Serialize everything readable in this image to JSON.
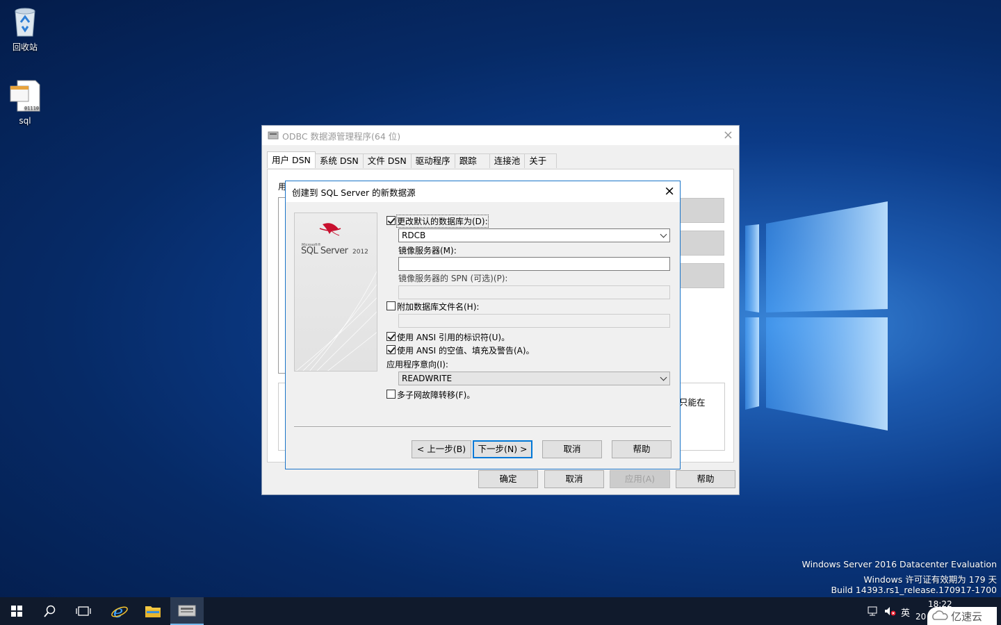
{
  "desktop": {
    "icons": [
      {
        "label": "回收站",
        "icon": "recycle-bin-icon"
      },
      {
        "label": "sql",
        "icon": "dsn-file-icon"
      }
    ],
    "watermark": {
      "line1": "Windows Server 2016 Datacenter Evaluation",
      "line2": "Windows 许可证有效期为 179 天",
      "line3": "Build 14393.rs1_release.170917-1700"
    }
  },
  "odbc_window": {
    "title": "ODBC 数据源管理程序(64 位)",
    "tabs": [
      "用户 DSN",
      "系统 DSN",
      "文件 DSN",
      "驱动程序",
      "跟踪",
      "连接池",
      "关于"
    ],
    "partial_label": "用",
    "partial_text": "只能在",
    "buttons": {
      "ok": "确定",
      "cancel": "取消",
      "apply": "应用(A)",
      "help": "帮助"
    }
  },
  "dialog": {
    "title": "创建到 SQL Server 的新数据源",
    "logo": {
      "small": "Microsoft®",
      "product": "SQL Server",
      "version": "2012"
    },
    "change_default_db": {
      "label": "更改默认的数据库为(D):",
      "checked": true
    },
    "default_db": "RDCB",
    "mirror_server": {
      "label": "镜像服务器(M):",
      "value": ""
    },
    "mirror_spn": {
      "label": "镜像服务器的 SPN (可选)(P):",
      "value": ""
    },
    "attach_db": {
      "label": "附加数据库文件名(H):",
      "checked": false,
      "value": ""
    },
    "ansi_quoted": {
      "label": "使用 ANSI 引用的标识符(U)。",
      "checked": true
    },
    "ansi_nulls": {
      "label": "使用 ANSI 的空值、填充及警告(A)。",
      "checked": true
    },
    "app_intent": {
      "label": "应用程序意向(I):",
      "value": "READWRITE"
    },
    "multisubnet": {
      "label": "多子网故障转移(F)。",
      "checked": false
    },
    "buttons": {
      "back": "< 上一步(B)",
      "next": "下一步(N) >",
      "cancel": "取消",
      "help": "帮助"
    }
  },
  "taskbar": {
    "tray": {
      "network": "network-icon",
      "volume": "volume-muted-icon",
      "ime": "英",
      "time": "18:22",
      "date": "20"
    },
    "corner_logo": "亿速云"
  }
}
